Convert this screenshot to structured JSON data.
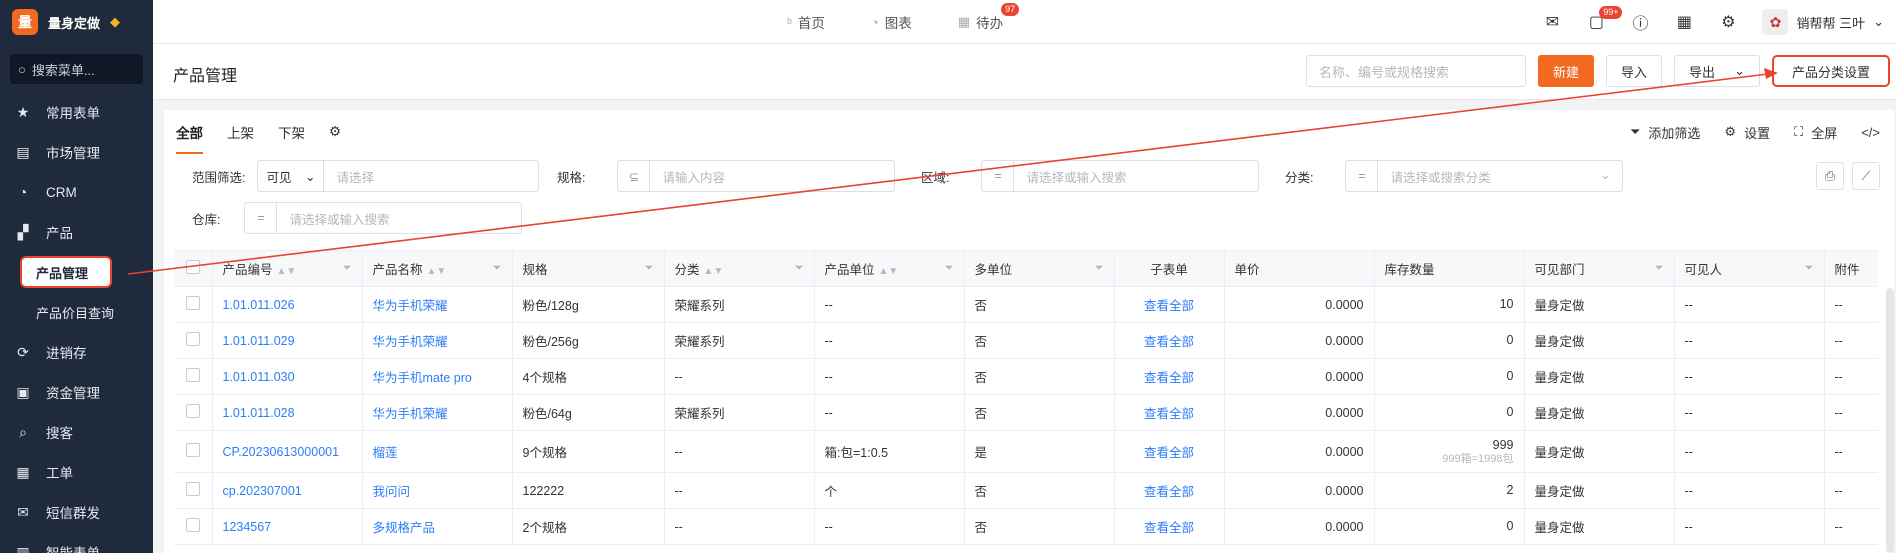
{
  "sidebar": {
    "brand_logo": "量",
    "brand_name": "量身定做",
    "search_placeholder": "搜索菜单...",
    "items": [
      {
        "label": "常用表单",
        "icon": "star-icon"
      },
      {
        "label": "市场管理",
        "icon": "clipboard-icon"
      },
      {
        "label": "CRM",
        "icon": "pie-icon"
      },
      {
        "label": "产品",
        "icon": "boxes-icon"
      }
    ],
    "subitems": [
      {
        "label": "产品管理",
        "active": true
      },
      {
        "label": "产品价目查询",
        "active": false
      }
    ],
    "items2": [
      {
        "label": "进销存",
        "icon": "refresh-icon"
      },
      {
        "label": "资金管理",
        "icon": "wallet-icon"
      },
      {
        "label": "搜客",
        "icon": "search-icon"
      },
      {
        "label": "工单",
        "icon": "ticket-icon"
      },
      {
        "label": "短信群发",
        "icon": "mail-icon"
      },
      {
        "label": "智能表单",
        "icon": "form-icon"
      }
    ]
  },
  "topbar": {
    "tabs": [
      {
        "label": "首页",
        "icon": "b-icon"
      },
      {
        "label": "图表",
        "icon": "chart-icon"
      },
      {
        "label": "待办",
        "icon": "calendar-icon",
        "badge": "97"
      }
    ],
    "message_badge": "99+",
    "user_name": "销帮帮 三叶"
  },
  "page": {
    "title": "产品管理",
    "search_placeholder": "名称、编号或规格搜索",
    "btn_new": "新建",
    "btn_import": "导入",
    "btn_export": "导出",
    "btn_category": "产品分类设置"
  },
  "tabs": [
    "全部",
    "上架",
    "下架"
  ],
  "tools": {
    "add_filter": "添加筛选",
    "settings": "设置",
    "fullscreen": "全屏"
  },
  "filters": {
    "scope_label": "范围筛选:",
    "scope_value": "可见",
    "scope_placeholder": "请选择",
    "spec_label": "规格:",
    "spec_placeholder": "请输入内容",
    "region_label": "区域:",
    "region_placeholder": "请选择或输入搜索",
    "category_label": "分类:",
    "category_placeholder": "请选择或搜索分类",
    "warehouse_label": "仓库:",
    "warehouse_placeholder": "请选择或输入搜索"
  },
  "table": {
    "headers": [
      "产品编号",
      "产品名称",
      "规格",
      "分类",
      "产品单位",
      "多单位",
      "子表单",
      "单价",
      "库存数量",
      "可见部门",
      "可见人",
      "附件"
    ],
    "rows": [
      {
        "code": "1.01.011.026",
        "name": "华为手机荣耀",
        "spec": "粉色/128g",
        "cat": "荣耀系列",
        "unit": "--",
        "multi": "否",
        "sub": "查看全部",
        "price": "0.0000",
        "stock": "10",
        "stock_sub": "",
        "dept": "量身定做",
        "person": "--",
        "attach": "--"
      },
      {
        "code": "1.01.011.029",
        "name": "华为手机荣耀",
        "spec": "粉色/256g",
        "cat": "荣耀系列",
        "unit": "--",
        "multi": "否",
        "sub": "查看全部",
        "price": "0.0000",
        "stock": "0",
        "stock_sub": "",
        "dept": "量身定做",
        "person": "--",
        "attach": "--"
      },
      {
        "code": "1.01.011.030",
        "name": "华为手机mate pro",
        "spec": "4个规格",
        "cat": "--",
        "unit": "--",
        "multi": "否",
        "sub": "查看全部",
        "price": "0.0000",
        "stock": "0",
        "stock_sub": "",
        "dept": "量身定做",
        "person": "--",
        "attach": "--"
      },
      {
        "code": "1.01.011.028",
        "name": "华为手机荣耀",
        "spec": "粉色/64g",
        "cat": "荣耀系列",
        "unit": "--",
        "multi": "否",
        "sub": "查看全部",
        "price": "0.0000",
        "stock": "0",
        "stock_sub": "",
        "dept": "量身定做",
        "person": "--",
        "attach": "--"
      },
      {
        "code": "CP.20230613000001",
        "name": "榴莲",
        "spec": "9个规格",
        "cat": "--",
        "unit": "箱:包=1:0.5",
        "multi": "是",
        "sub": "查看全部",
        "price": "0.0000",
        "stock": "999",
        "stock_sub": "999箱=1998包",
        "dept": "量身定做",
        "person": "--",
        "attach": "--"
      },
      {
        "code": "cp.202307001",
        "name": "我问问",
        "spec": "122222",
        "cat": "--",
        "unit": "个",
        "multi": "否",
        "sub": "查看全部",
        "price": "0.0000",
        "stock": "2",
        "stock_sub": "",
        "dept": "量身定做",
        "person": "--",
        "attach": "--"
      },
      {
        "code": "1234567",
        "name": "多规格产品",
        "spec": "2个规格",
        "cat": "--",
        "unit": "--",
        "multi": "否",
        "sub": "查看全部",
        "price": "0.0000",
        "stock": "0",
        "stock_sub": "",
        "dept": "量身定做",
        "person": "--",
        "attach": "--"
      }
    ]
  }
}
